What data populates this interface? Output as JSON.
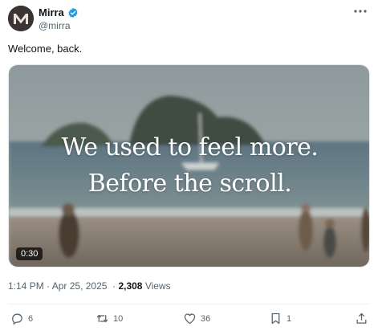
{
  "author": {
    "display_name": "Mirra",
    "handle": "@mirra",
    "avatar_letter": "M",
    "verified": true
  },
  "tweet": {
    "text": "Welcome, back."
  },
  "media": {
    "overlay_line1": "We used to feel more.",
    "overlay_line2": "Before the scroll.",
    "duration": "0:30"
  },
  "meta": {
    "time": "1:14 PM",
    "separator": " · ",
    "date": "Apr 25, 2025",
    "views_count": "2,308",
    "views_label": "Views"
  },
  "actions": {
    "replies": "6",
    "reposts": "10",
    "likes": "36",
    "bookmarks": "1"
  },
  "colors": {
    "verified_blue": "#1d9bf0",
    "text_primary": "#0f1419",
    "text_secondary": "#536471"
  }
}
